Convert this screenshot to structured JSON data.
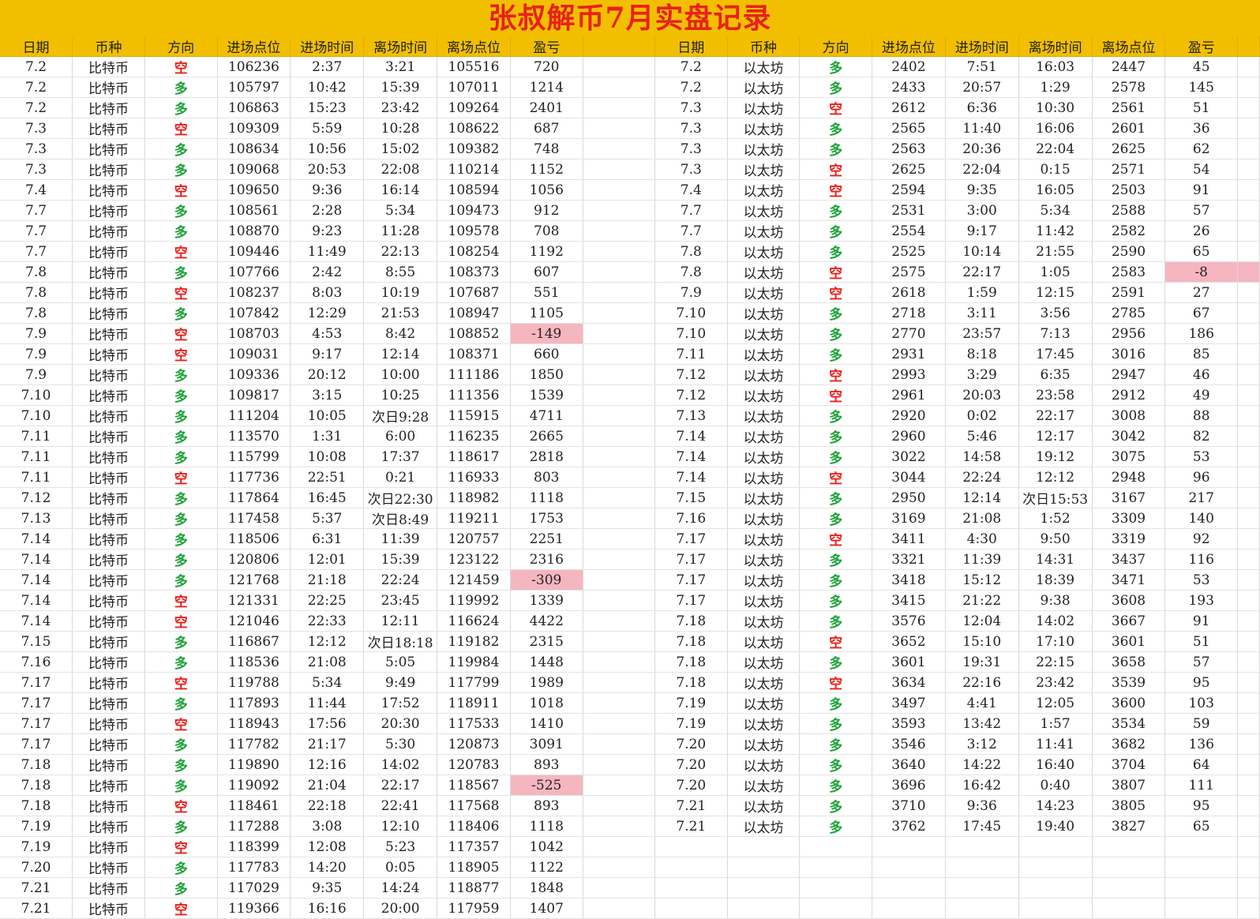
{
  "title": "张叔解币7月实盘记录",
  "colors": {
    "title_bg": "#f2bf00",
    "title_text": "#e8211c",
    "long": "#1aa336",
    "short": "#e8211c",
    "loss_bg": "#f6b6c0"
  },
  "headers": [
    "日期",
    "币种",
    "方向",
    "进场点位",
    "进场时间",
    "离场时间",
    "离场点位",
    "盈亏"
  ],
  "btc_rows": [
    [
      "7.2",
      "比特币",
      "空",
      "106236",
      "2:37",
      "3:21",
      "105516",
      "720"
    ],
    [
      "7.2",
      "比特币",
      "多",
      "105797",
      "10:42",
      "15:39",
      "107011",
      "1214"
    ],
    [
      "7.2",
      "比特币",
      "多",
      "106863",
      "15:23",
      "23:42",
      "109264",
      "2401"
    ],
    [
      "7.3",
      "比特币",
      "空",
      "109309",
      "5:59",
      "10:28",
      "108622",
      "687"
    ],
    [
      "7.3",
      "比特币",
      "多",
      "108634",
      "10:56",
      "15:02",
      "109382",
      "748"
    ],
    [
      "7.3",
      "比特币",
      "多",
      "109068",
      "20:53",
      "22:08",
      "110214",
      "1152"
    ],
    [
      "7.4",
      "比特币",
      "空",
      "109650",
      "9:36",
      "16:14",
      "108594",
      "1056"
    ],
    [
      "7.7",
      "比特币",
      "多",
      "108561",
      "2:28",
      "5:34",
      "109473",
      "912"
    ],
    [
      "7.7",
      "比特币",
      "多",
      "108870",
      "9:23",
      "11:28",
      "109578",
      "708"
    ],
    [
      "7.7",
      "比特币",
      "空",
      "109446",
      "11:49",
      "22:13",
      "108254",
      "1192"
    ],
    [
      "7.8",
      "比特币",
      "多",
      "107766",
      "2:42",
      "8:55",
      "108373",
      "607"
    ],
    [
      "7.8",
      "比特币",
      "空",
      "108237",
      "8:03",
      "10:19",
      "107687",
      "551"
    ],
    [
      "7.8",
      "比特币",
      "多",
      "107842",
      "12:29",
      "21:53",
      "108947",
      "1105"
    ],
    [
      "7.9",
      "比特币",
      "空",
      "108703",
      "4:53",
      "8:42",
      "108852",
      "-149"
    ],
    [
      "7.9",
      "比特币",
      "空",
      "109031",
      "9:17",
      "12:14",
      "108371",
      "660"
    ],
    [
      "7.9",
      "比特币",
      "多",
      "109336",
      "20:12",
      "10:00",
      "111186",
      "1850"
    ],
    [
      "7.10",
      "比特币",
      "多",
      "109817",
      "3:15",
      "10:25",
      "111356",
      "1539"
    ],
    [
      "7.10",
      "比特币",
      "多",
      "111204",
      "10:05",
      "次日9:28",
      "115915",
      "4711"
    ],
    [
      "7.11",
      "比特币",
      "多",
      "113570",
      "1:31",
      "6:00",
      "116235",
      "2665"
    ],
    [
      "7.11",
      "比特币",
      "多",
      "115799",
      "10:08",
      "17:37",
      "118617",
      "2818"
    ],
    [
      "7.11",
      "比特币",
      "空",
      "117736",
      "22:51",
      "0:21",
      "116933",
      "803"
    ],
    [
      "7.12",
      "比特币",
      "多",
      "117864",
      "16:45",
      "次日22:30",
      "118982",
      "1118"
    ],
    [
      "7.13",
      "比特币",
      "多",
      "117458",
      "5:37",
      "次日8:49",
      "119211",
      "1753"
    ],
    [
      "7.14",
      "比特币",
      "多",
      "118506",
      "6:31",
      "11:39",
      "120757",
      "2251"
    ],
    [
      "7.14",
      "比特币",
      "多",
      "120806",
      "12:01",
      "15:39",
      "123122",
      "2316"
    ],
    [
      "7.14",
      "比特币",
      "多",
      "121768",
      "21:18",
      "22:24",
      "121459",
      "-309"
    ],
    [
      "7.14",
      "比特币",
      "空",
      "121331",
      "22:25",
      "23:45",
      "119992",
      "1339"
    ],
    [
      "7.14",
      "比特币",
      "空",
      "121046",
      "22:33",
      "12:11",
      "116624",
      "4422"
    ],
    [
      "7.15",
      "比特币",
      "多",
      "116867",
      "12:12",
      "次日18:18",
      "119182",
      "2315"
    ],
    [
      "7.16",
      "比特币",
      "多",
      "118536",
      "21:08",
      "5:05",
      "119984",
      "1448"
    ],
    [
      "7.17",
      "比特币",
      "空",
      "119788",
      "5:34",
      "9:49",
      "117799",
      "1989"
    ],
    [
      "7.17",
      "比特币",
      "多",
      "117893",
      "11:44",
      "17:52",
      "118911",
      "1018"
    ],
    [
      "7.17",
      "比特币",
      "空",
      "118943",
      "17:56",
      "20:30",
      "117533",
      "1410"
    ],
    [
      "7.17",
      "比特币",
      "多",
      "117782",
      "21:17",
      "5:30",
      "120873",
      "3091"
    ],
    [
      "7.18",
      "比特币",
      "多",
      "119890",
      "12:16",
      "14:02",
      "120783",
      "893"
    ],
    [
      "7.18",
      "比特币",
      "多",
      "119092",
      "21:04",
      "22:17",
      "118567",
      "-525"
    ],
    [
      "7.18",
      "比特币",
      "空",
      "118461",
      "22:18",
      "22:41",
      "117568",
      "893"
    ],
    [
      "7.19",
      "比特币",
      "多",
      "117288",
      "3:08",
      "12:10",
      "118406",
      "1118"
    ],
    [
      "7.19",
      "比特币",
      "空",
      "118399",
      "12:08",
      "5:23",
      "117357",
      "1042"
    ],
    [
      "7.20",
      "比特币",
      "多",
      "117783",
      "14:20",
      "0:05",
      "118905",
      "1122"
    ],
    [
      "7.21",
      "比特币",
      "多",
      "117029",
      "9:35",
      "14:24",
      "118877",
      "1848"
    ],
    [
      "7.21",
      "比特币",
      "空",
      "119366",
      "16:16",
      "20:00",
      "117959",
      "1407"
    ]
  ],
  "eth_rows": [
    [
      "7.2",
      "以太坊",
      "多",
      "2402",
      "7:51",
      "16:03",
      "2447",
      "45"
    ],
    [
      "7.2",
      "以太坊",
      "多",
      "2433",
      "20:57",
      "1:29",
      "2578",
      "145"
    ],
    [
      "7.3",
      "以太坊",
      "空",
      "2612",
      "6:36",
      "10:30",
      "2561",
      "51"
    ],
    [
      "7.3",
      "以太坊",
      "多",
      "2565",
      "11:40",
      "16:06",
      "2601",
      "36"
    ],
    [
      "7.3",
      "以太坊",
      "多",
      "2563",
      "20:36",
      "22:04",
      "2625",
      "62"
    ],
    [
      "7.3",
      "以太坊",
      "空",
      "2625",
      "22:04",
      "0:15",
      "2571",
      "54"
    ],
    [
      "7.4",
      "以太坊",
      "空",
      "2594",
      "9:35",
      "16:05",
      "2503",
      "91"
    ],
    [
      "7.7",
      "以太坊",
      "多",
      "2531",
      "3:00",
      "5:34",
      "2588",
      "57"
    ],
    [
      "7.7",
      "以太坊",
      "多",
      "2554",
      "9:17",
      "11:42",
      "2582",
      "26"
    ],
    [
      "7.8",
      "以太坊",
      "多",
      "2525",
      "10:14",
      "21:55",
      "2590",
      "65"
    ],
    [
      "7.8",
      "以太坊",
      "空",
      "2575",
      "22:17",
      "1:05",
      "2583",
      "-8"
    ],
    [
      "7.9",
      "以太坊",
      "空",
      "2618",
      "1:59",
      "12:15",
      "2591",
      "27"
    ],
    [
      "7.10",
      "以太坊",
      "多",
      "2718",
      "3:11",
      "3:56",
      "2785",
      "67"
    ],
    [
      "7.10",
      "以太坊",
      "多",
      "2770",
      "23:57",
      "7:13",
      "2956",
      "186"
    ],
    [
      "7.11",
      "以太坊",
      "多",
      "2931",
      "8:18",
      "17:45",
      "3016",
      "85"
    ],
    [
      "7.12",
      "以太坊",
      "空",
      "2993",
      "3:29",
      "6:35",
      "2947",
      "46"
    ],
    [
      "7.12",
      "以太坊",
      "空",
      "2961",
      "20:03",
      "23:58",
      "2912",
      "49"
    ],
    [
      "7.13",
      "以太坊",
      "多",
      "2920",
      "0:02",
      "22:17",
      "3008",
      "88"
    ],
    [
      "7.14",
      "以太坊",
      "多",
      "2960",
      "5:46",
      "12:17",
      "3042",
      "82"
    ],
    [
      "7.14",
      "以太坊",
      "多",
      "3022",
      "14:58",
      "19:12",
      "3075",
      "53"
    ],
    [
      "7.14",
      "以太坊",
      "空",
      "3044",
      "22:24",
      "12:12",
      "2948",
      "96"
    ],
    [
      "7.15",
      "以太坊",
      "多",
      "2950",
      "12:14",
      "次日15:53",
      "3167",
      "217"
    ],
    [
      "7.16",
      "以太坊",
      "多",
      "3169",
      "21:08",
      "1:52",
      "3309",
      "140"
    ],
    [
      "7.17",
      "以太坊",
      "空",
      "3411",
      "4:30",
      "9:50",
      "3319",
      "92"
    ],
    [
      "7.17",
      "以太坊",
      "多",
      "3321",
      "11:39",
      "14:31",
      "3437",
      "116"
    ],
    [
      "7.17",
      "以太坊",
      "多",
      "3418",
      "15:12",
      "18:39",
      "3471",
      "53"
    ],
    [
      "7.17",
      "以太坊",
      "多",
      "3415",
      "21:22",
      "9:38",
      "3608",
      "193"
    ],
    [
      "7.18",
      "以太坊",
      "多",
      "3576",
      "12:04",
      "14:02",
      "3667",
      "91"
    ],
    [
      "7.18",
      "以太坊",
      "空",
      "3652",
      "15:10",
      "17:10",
      "3601",
      "51"
    ],
    [
      "7.18",
      "以太坊",
      "多",
      "3601",
      "19:31",
      "22:15",
      "3658",
      "57"
    ],
    [
      "7.18",
      "以太坊",
      "空",
      "3634",
      "22:16",
      "23:42",
      "3539",
      "95"
    ],
    [
      "7.19",
      "以太坊",
      "多",
      "3497",
      "4:41",
      "12:05",
      "3600",
      "103"
    ],
    [
      "7.19",
      "以太坊",
      "多",
      "3593",
      "13:42",
      "1:57",
      "3534",
      "59"
    ],
    [
      "7.20",
      "以太坊",
      "多",
      "3546",
      "3:12",
      "11:41",
      "3682",
      "136"
    ],
    [
      "7.20",
      "以太坊",
      "多",
      "3640",
      "14:22",
      "16:40",
      "3704",
      "64"
    ],
    [
      "7.20",
      "以太坊",
      "多",
      "3696",
      "16:42",
      "0:40",
      "3807",
      "111"
    ],
    [
      "7.21",
      "以太坊",
      "多",
      "3710",
      "9:36",
      "14:23",
      "3805",
      "95"
    ],
    [
      "7.21",
      "以太坊",
      "多",
      "3762",
      "17:45",
      "19:40",
      "3827",
      "65"
    ]
  ]
}
